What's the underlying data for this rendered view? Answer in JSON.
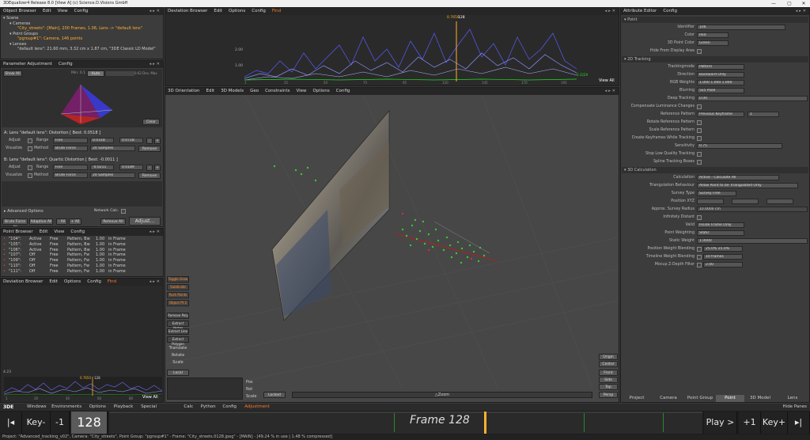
{
  "window": {
    "title": "3DEqualizer4 Release 8.0  [View A]   (c) Science.D.Visions GmbH",
    "controls": [
      "—",
      "▢",
      "✕"
    ]
  },
  "object_browser": {
    "header": [
      "Object Browser",
      "Edit",
      "View",
      "Config"
    ],
    "tree": [
      "Scene",
      "Cameras",
      "\"City_streets\": [Main], 200 Frames, 1.06, Lens -> \"default lens\"",
      "Point Groups",
      "\"pgroup#1\": Camera, 146 points",
      "Lenses",
      "\"default lens\": 21.60 mm, 3.32 cm x 1.87 cm, \"3DE Classic LD Model\""
    ]
  },
  "param_adjust": {
    "header": [
      "Parameter Adjustment",
      "Config"
    ],
    "show_all": "Show All",
    "min": "Min: 0.1",
    "auto": "Auto",
    "right_label": "0.62  Dev. Max",
    "clear": "Clear",
    "a_title": "A: Lens \"default lens\": Distortion  [ Best: 0.0518 ]",
    "b_title": "B: Lens \"default lens\": Quartic Distortion  [ Best: -0.0011 ]",
    "adjust": "Adjust",
    "range": "Range",
    "range_val": "Fine",
    "visualize": "Visualize",
    "method": "Method",
    "method_val": "Brute Force",
    "samples": "20 Samples",
    "remove": "Remove",
    "a_v1": "0.0318",
    "a_v2": "0.0718",
    "b_v1": "-0.0211",
    "b_v2": "0.0189",
    "minus": "-",
    "plus": "+",
    "advanced": "Advanced Options",
    "network": "Network Calc.",
    "bf_all": "Brute Force All",
    "adaptive_all": "Adaptive All",
    "m_all": "- All",
    "p_all": "+ All",
    "remove_all": "Remove All",
    "adjust_btn": "Adjust..."
  },
  "point_browser": {
    "header": [
      "Point Browser",
      "Edit",
      "View",
      "Config"
    ],
    "rows": [
      [
        "\"104\":",
        "Active",
        "Free",
        "Pattern, Bw",
        "1.00",
        "in Frame"
      ],
      [
        "\"105\":",
        "Active",
        "Free",
        "Pattern, Bw",
        "1.00",
        "in Frame"
      ],
      [
        "\"106\":",
        "Active",
        "Free",
        "Pattern, Bw",
        "1.00",
        "in Frame"
      ],
      [
        "\"107\":",
        "Off",
        "Free",
        "Pattern, Fw",
        "1.00",
        "in Frame"
      ],
      [
        "\"109\":",
        "Off",
        "Free",
        "Pattern, Fw",
        "1.00",
        "in Frame"
      ],
      [
        "\"110\":",
        "Off",
        "Free",
        "Pattern, Fw",
        "1.00",
        "in Frame"
      ],
      [
        "\"111\":",
        "Off",
        "Free",
        "Pattern, Fw",
        "1.00",
        "in Frame"
      ]
    ]
  },
  "dev_small": {
    "header": [
      "Deviation Browser",
      "Edit",
      "Options",
      "Config",
      "Find"
    ],
    "y_label": "4.23",
    "marker": "0.7650",
    "frame": "128",
    "view_all": "View All",
    "ticks": [
      "1",
      "20",
      "40",
      "60",
      "80"
    ]
  },
  "dev_top": {
    "header": [
      "Deviation Browser",
      "Edit",
      "Options",
      "Config",
      "Find"
    ],
    "y_labels": [
      "2.00",
      "1.00"
    ],
    "marker": "0.7650",
    "frame": "128",
    "view_all": "View All",
    "ticks": [
      "1",
      "25",
      "50",
      "75",
      "95",
      "120",
      "145",
      "170",
      "195"
    ],
    "avg": "0.3229"
  },
  "orient": {
    "header": [
      "3D Orientation",
      "Edit",
      "3D Models",
      "Geo",
      "Constraints",
      "View",
      "Options",
      "Config"
    ],
    "tools": [
      "Toggle Grow",
      "Subdivide",
      "Push Points",
      "Object Pt 2",
      "Remove Poly",
      "Extract Vertex",
      "Extract Line",
      "Extract Polygon"
    ],
    "tool_orange": [
      true,
      true,
      true,
      true,
      false,
      false,
      false,
      false
    ],
    "translate": "Translate",
    "rotate": "Rotate",
    "scale": "Scale",
    "local": "Local",
    "pos": "Pos",
    "rot": "Rot",
    "scale2": "Scale",
    "locked": "Locked",
    "zoom": "△Zoom",
    "right_btns": [
      "Origin",
      "Center",
      "Front",
      "Side",
      "Top",
      "Persp"
    ]
  },
  "attr": {
    "header": [
      "Attribute Editor",
      "Config"
    ],
    "point": "Point",
    "identifier_l": "Identifier",
    "identifier": "106",
    "color_l": "Color",
    "color": "Red",
    "color3d_l": "3D Point Color",
    "color3d": "Green",
    "hide_l": "Hide From Display Area",
    "sec2d": "2D Tracking",
    "tm_l": "Trackingmode",
    "tm": "Pattern",
    "dir_l": "Direction",
    "dir": "Backward Only",
    "rgb_l": "RGB Weights",
    "rgb": "1.000 1.000 1.000",
    "blur_l": "Blurring",
    "blur": "5x5 Pixel",
    "deep_l": "Deep Tracking",
    "deep": "0.00",
    "comp_l": "Compensate Luminance Changes",
    "refp_l": "Reference Pattern",
    "refp": "Previous Keyframe",
    "refp2": "1",
    "rot_l": "Rotate Reference Pattern",
    "scale_l": "Scale Reference Pattern",
    "ck_l": "Create Keyframes While Tracking",
    "sens_l": "Sensitivity",
    "sens": "0.75",
    "stop_l": "Stop Low Quality Tracking",
    "spline_l": "Spline Tracking Boxes",
    "sec3d": "3D Calculation",
    "calc_l": "Calculation",
    "calc": "Active - Calculate All",
    "tri_l": "Triangulation Behaviour",
    "tri": "Allow Point to be Triangulated Only",
    "st_l": "Survey Type",
    "st": "Survey Free",
    "pos_l": "Position XYZ",
    "asr_l": "Approx. Survey Radius",
    "asr": "10.0000 cm",
    "inf_l": "Infinitely Distant",
    "valid_l": "Valid",
    "valid": "Inside Frame Only",
    "pw_l": "Point Weighting",
    "pw": "Static",
    "sw_l": "Static Weight",
    "sw": "1.0000",
    "pwb_l": "Position Weight Blending",
    "pwb": "25.0%  25.0%",
    "twb_l": "Timeline Weight Blending",
    "twb": "10 frames",
    "moc_l": "Mocup Z-Depth Filter",
    "moc": "2.00",
    "tabs": [
      "Project",
      "Camera",
      "Point Group",
      "Point",
      "3D Model",
      "Lens"
    ]
  },
  "menubar": {
    "logo": "3DE",
    "items": [
      "Windows",
      "Environments",
      "Options",
      "Playback",
      "Special Frames",
      "Calc",
      "Python",
      "Config",
      "Adjustment"
    ],
    "hide": "Hide Panes"
  },
  "timeline": {
    "first": "|◂",
    "keyprev": "Key-",
    "minus1": "-1",
    "frame_num": "128",
    "frame_label": "Frame 128",
    "play": "Play >",
    "plus1": "+1",
    "keynext": "Key+",
    "last": "▸|"
  },
  "status": "Project: \"Advanced_tracking_v02\", Camera: \"City_streets\", Point Group: \"pgroup#1\" - Frame: \"City_streets.0128.jpeg\" - [MAIN] - [49.24 % in use | 1.48 % compressed]"
}
